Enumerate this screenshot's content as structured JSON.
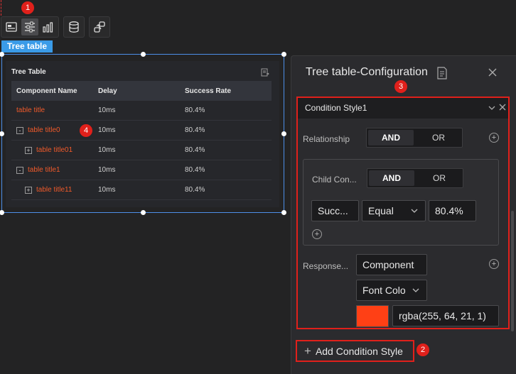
{
  "toolbar": {
    "left_group": [
      "image-icon",
      "sliders-icon",
      "bar-chart-icon"
    ],
    "data_button_icon": "database-icon",
    "link_button_icon": "link-icon"
  },
  "markers": {
    "m1": "1",
    "m2": "2",
    "m3": "3",
    "m4": "4"
  },
  "component_tag": "Tree table",
  "tree_table": {
    "title": "Tree Table",
    "export_icon": "export-icon",
    "columns": [
      "Component Name",
      "Delay",
      "Success Rate"
    ],
    "rows": [
      {
        "name": "table title",
        "expander": "",
        "delay": "10ms",
        "rate": "80.4%"
      },
      {
        "name": "table title0",
        "expander": "-",
        "delay": "10ms",
        "rate": "80.4%"
      },
      {
        "name": "table title01",
        "expander": "+",
        "delay": "10ms",
        "rate": "80.4%"
      },
      {
        "name": "table title1",
        "expander": "-",
        "delay": "10ms",
        "rate": "80.4%"
      },
      {
        "name": "table title11",
        "expander": "+",
        "delay": "10ms",
        "rate": "80.4%"
      }
    ]
  },
  "panel": {
    "title": "Tree table-Configuration",
    "condition": {
      "header": "Condition Style1",
      "relationship_label": "Relationship",
      "relationship_options": [
        "AND",
        "OR"
      ],
      "relationship_selected": "AND",
      "child_label": "Child Con...",
      "child_options": [
        "AND",
        "OR"
      ],
      "child_selected": "AND",
      "field_value": "Succ...",
      "operator_value": "Equal",
      "compare_value": "80.4%",
      "response_label": "Response...",
      "response_target": "Component",
      "response_property": "Font Colo",
      "color_value": "rgba(255, 64, 21, 1)",
      "color_hex": "#ff4015"
    },
    "add_condition_label": "Add Condition Style"
  },
  "colors": {
    "accent": "#3a9be8",
    "highlight": "#e0201b",
    "row_text": "#f05a2b"
  }
}
